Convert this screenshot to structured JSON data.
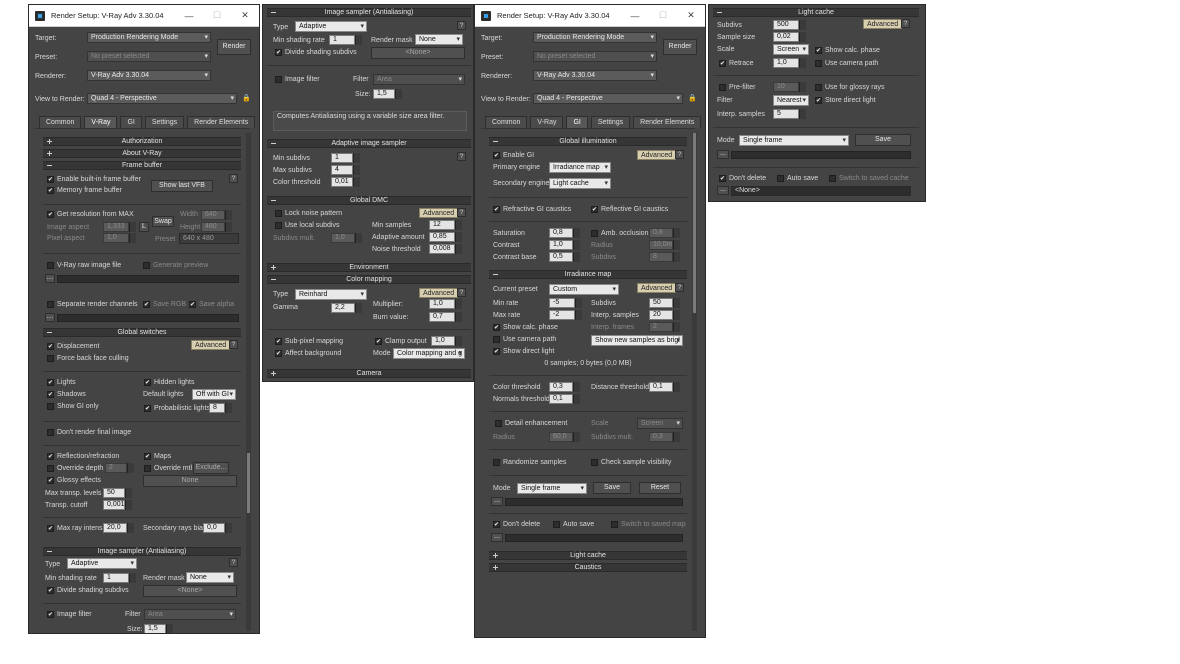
{
  "panel1": {
    "title": "Render Setup: V-Ray Adv 3.30.04",
    "target_label": "Target:",
    "target_value": "Production Rendering Mode",
    "preset_label": "Preset:",
    "preset_value": "No preset selected",
    "renderer_label": "Renderer:",
    "renderer_value": "V-Ray Adv 3.30.04",
    "view_label": "View to Render:",
    "view_value": "Quad 4 - Perspective",
    "render_button": "Render",
    "tabs": [
      "Common",
      "V-Ray",
      "GI",
      "Settings",
      "Render Elements"
    ],
    "rollouts": {
      "authorization": "Authorization",
      "about": "About V-Ray",
      "frame_buffer": "Frame buffer",
      "global_switches": "Global switches",
      "image_sampler": "Image sampler (Antialiasing)"
    },
    "fb": {
      "enable_vfb": "Enable built-in frame buffer",
      "memory_fb": "Memory frame buffer",
      "show_last_vfb": "Show last VFB",
      "get_res": "Get resolution from MAX",
      "image_aspect_label": "Image aspect",
      "image_aspect_value": "1,333",
      "lock_l": "L",
      "swap": "Swap",
      "width_label": "Width",
      "width_value": "640",
      "height_label": "Height",
      "height_value": "480",
      "pixel_aspect_label": "Pixel aspect",
      "pixel_aspect_value": "1,0",
      "preset_label": "Preset",
      "preset_value": "640 x 480",
      "raw_image": "V-Ray raw image file",
      "generate_preview": "Generate preview",
      "sep_channels": "Separate render channels",
      "save_rgb": "Save RGB",
      "save_alpha": "Save alpha"
    },
    "gs": {
      "displacement": "Displacement",
      "advanced": "Advanced",
      "force_back": "Force back face culling",
      "lights": "Lights",
      "hidden_lights": "Hidden lights",
      "shadows": "Shadows",
      "default_lights_label": "Default lights",
      "default_lights_value": "Off with GI",
      "show_gi_only": "Show GI only",
      "prob_lights": "Probabilistic lights",
      "prob_lights_value": "8",
      "dont_render": "Don't render final image",
      "refl_refr": "Reflection/refraction",
      "maps": "Maps",
      "override_depth": "Override depth",
      "override_depth_value": "2",
      "override_mtl": "Override mtl",
      "exclude": "Exclude...",
      "none": "None",
      "glossy": "Glossy effects",
      "max_transp_label": "Max transp. levels",
      "max_transp_value": "50",
      "transp_cutoff_label": "Transp. cutoff",
      "transp_cutoff_value": "0,001",
      "max_ray_label": "Max ray intens",
      "max_ray_value": "20,0",
      "secondary_bias_label": "Secondary rays bias",
      "secondary_bias_value": "0,0"
    },
    "is": {
      "type_label": "Type",
      "type_value": "Adaptive",
      "min_shading_label": "Min shading rate",
      "min_shading_value": "1",
      "render_mask_label": "Render mask",
      "render_mask_value": "None",
      "divide": "Divide shading subdivs",
      "none_button": "<None>",
      "image_filter": "Image filter",
      "filter_label": "Filter",
      "filter_value": "Area",
      "size_label": "Size:",
      "size_value": "1,5"
    }
  },
  "panel2": {
    "rollouts": {
      "image_sampler": "Image sampler (Antialiasing)",
      "adaptive": "Adaptive image sampler",
      "dmc": "Global DMC",
      "environment": "Environment",
      "color_mapping": "Color mapping",
      "camera": "Camera"
    },
    "is": {
      "type_label": "Type",
      "type_value": "Adaptive",
      "min_shading_label": "Min shading rate",
      "min_shading_value": "1",
      "render_mask_label": "Render mask",
      "render_mask_value": "None",
      "divide": "Divide shading subdivs",
      "none_button": "<None>",
      "image_filter": "Image filter",
      "filter_label": "Filter",
      "filter_value": "Area",
      "size_label": "Size:",
      "size_value": "1,5",
      "description": "Computes Antialiasing using a variable size area filter."
    },
    "ais": {
      "min_subdivs_label": "Min subdivs",
      "min_subdivs_value": "1",
      "max_subdivs_label": "Max subdivs",
      "max_subdivs_value": "4",
      "color_thresh_label": "Color threshold",
      "color_thresh_value": "0,01"
    },
    "dmc": {
      "lock_noise": "Lock noise pattern",
      "advanced": "Advanced",
      "use_local": "Use local subdivs",
      "min_samples_label": "Min samples",
      "min_samples_value": "12",
      "subdivs_mult_label": "Subdivs mult.",
      "subdivs_mult_value": "1,0",
      "adaptive_amount_label": "Adaptive amount",
      "adaptive_amount_value": "0,85",
      "noise_thresh_label": "Noise threshold",
      "noise_thresh_value": "0,008"
    },
    "cm": {
      "type_label": "Type",
      "type_value": "Reinhard",
      "advanced": "Advanced",
      "gamma_label": "Gamma",
      "gamma_value": "2,2",
      "multiplier_label": "Multiplier:",
      "multiplier_value": "1,0",
      "burn_label": "Burn value:",
      "burn_value": "0,7",
      "subpixel": "Sub-pixel mapping",
      "clamp": "Clamp output",
      "clamp_value": "1,0",
      "affect_bg": "Affect background",
      "mode_label": "Mode",
      "mode_value": "Color mapping and g"
    }
  },
  "panel3": {
    "title": "Render Setup: V-Ray Adv 3.30.04",
    "target_label": "Target:",
    "target_value": "Production Rendering Mode",
    "preset_label": "Preset:",
    "preset_value": "No preset selected",
    "renderer_label": "Renderer:",
    "renderer_value": "V-Ray Adv 3.30.04",
    "view_label": "View to Render:",
    "view_value": "Quad 4 - Perspective",
    "render_button": "Render",
    "tabs": [
      "Common",
      "V-Ray",
      "GI",
      "Settings",
      "Render Elements"
    ],
    "rollouts": {
      "gi": "Global illumination",
      "irradiance": "Irradiance map",
      "light_cache": "Light cache",
      "caustics": "Caustics"
    },
    "gi": {
      "enable": "Enable GI",
      "advanced": "Advanced",
      "primary_label": "Primary engine",
      "primary_value": "Irradiance map",
      "secondary_label": "Secondary engine",
      "secondary_value": "Light cache",
      "refr_caustics": "Refractive GI caustics",
      "refl_caustics": "Reflective GI caustics",
      "saturation_label": "Saturation",
      "saturation_value": "0,8",
      "amb_occ": "Amb. occlusion",
      "amb_occ_value": "0,8",
      "contrast_label": "Contrast",
      "contrast_value": "1,0",
      "radius_label": "Radius",
      "radius_value": "10,0mm",
      "contrast_base_label": "Contrast base",
      "contrast_base_value": "0,5",
      "subdivs_label": "Subdivs",
      "subdivs_value": "8"
    },
    "im": {
      "current_preset_label": "Current preset",
      "current_preset_value": "Custom",
      "advanced": "Advanced",
      "min_rate_label": "Min rate",
      "min_rate_value": "-5",
      "subdivs_label": "Subdivs",
      "subdivs_value": "50",
      "max_rate_label": "Max rate",
      "max_rate_value": "-2",
      "interp_samples_label": "Interp. samples",
      "interp_samples_value": "20",
      "show_calc": "Show calc. phase",
      "interp_frames_label": "Interp. frames",
      "interp_frames_value": "2",
      "use_camera_path": "Use camera path",
      "show_new_samples": "Show new samples as brigl",
      "show_direct": "Show direct light",
      "samples_info": "0 samples; 0 bytes (0,0 MB)",
      "color_thresh_label": "Color threshold",
      "color_thresh_value": "0,3",
      "distance_thresh_label": "Distance threshold",
      "distance_thresh_value": "0,1",
      "normals_thresh_label": "Normals threshold",
      "normals_thresh_value": "0,1",
      "detail": "Detail enhancement",
      "scale_label": "Scale",
      "scale_value": "Screen",
      "radius_label": "Radius",
      "radius_value": "60,0",
      "subdivs_mult_label": "Subdivs mult.",
      "subdivs_mult_value": "0,3",
      "randomize": "Randomize samples",
      "check_visibility": "Check sample visibility",
      "mode_label": "Mode",
      "mode_value": "Single frame",
      "save": "Save",
      "reset": "Reset",
      "dont_delete": "Don't delete",
      "auto_save": "Auto save",
      "switch_saved": "Switch to saved map",
      "browse": "..."
    }
  },
  "panel4": {
    "rollout": "Light cache",
    "subdivs_label": "Subdivs",
    "subdivs_value": "500",
    "advanced": "Advanced",
    "sample_size_label": "Sample size",
    "sample_size_value": "0,02",
    "scale_label": "Scale",
    "scale_value": "Screen",
    "show_calc": "Show calc. phase",
    "retrace": "Retrace",
    "retrace_value": "1,0",
    "use_camera_path": "Use camera path",
    "prefilter": "Pre-filter",
    "prefilter_value": "10",
    "glossy_rays": "Use for glossy rays",
    "filter_label": "Filter",
    "filter_value": "Nearest",
    "store_direct": "Store direct light",
    "interp_label": "Interp. samples",
    "interp_value": "5",
    "mode_label": "Mode",
    "mode_value": "Single frame",
    "save": "Save",
    "dont_delete": "Don't delete",
    "auto_save": "Auto save",
    "switch_saved": "Switch to saved cache",
    "browse": "...",
    "none_file": "<None>"
  }
}
